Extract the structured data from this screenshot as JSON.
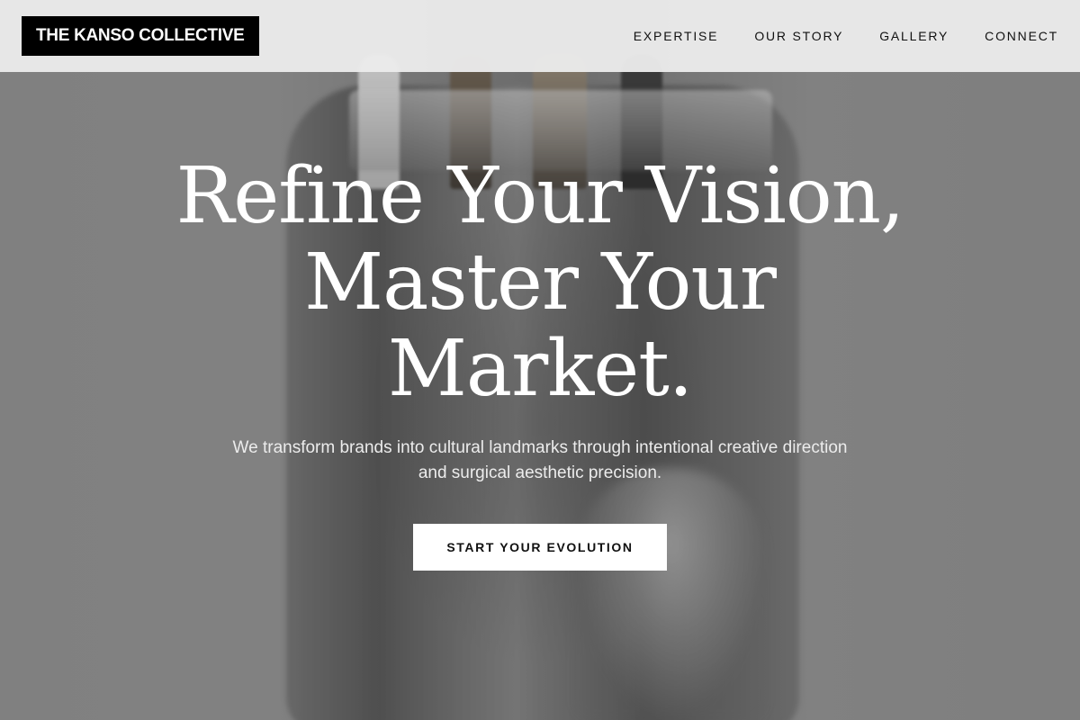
{
  "header": {
    "logo": "THE KANSO COLLECTIVE",
    "nav": [
      {
        "label": "EXPERTISE"
      },
      {
        "label": "OUR STORY"
      },
      {
        "label": "GALLERY"
      },
      {
        "label": "CONNECT"
      }
    ]
  },
  "hero": {
    "headline_lines": [
      "Refine Your Vision,",
      "Master Your",
      "Market."
    ],
    "subtext": "We transform brands into cultural landmarks through intentional creative direction and surgical aesthetic precision.",
    "cta_label": "START YOUR EVOLUTION"
  }
}
